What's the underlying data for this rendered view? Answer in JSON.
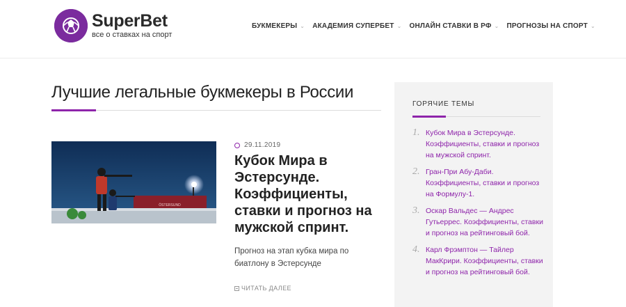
{
  "header": {
    "brand": "SuperBet",
    "tagline": "все о ставках на спорт",
    "nav": [
      {
        "label": "БУКМЕКЕРЫ"
      },
      {
        "label": "АКАДЕМИЯ СУПЕРБЕТ"
      },
      {
        "label": "ОНЛАЙН СТАВКИ В РФ"
      },
      {
        "label": "ПРОГНОЗЫ НА СПОРТ"
      }
    ]
  },
  "main": {
    "page_title": "Лучшие легальные букмекеры в России",
    "article": {
      "date": "29.11.2019",
      "title": "Кубок Мира в Эстерсунде. Коэффициенты, ставки и прогноз на мужской спринт.",
      "excerpt": "Прогноз на этап кубка мира по биатлону в Эстерсунде",
      "read_more": "ЧИТАТЬ ДАЛЕЕ",
      "image_caption": "ÖSTERSUND"
    }
  },
  "sidebar": {
    "title": "ГОРЯЧИЕ ТЕМЫ",
    "topics": [
      {
        "num": "1.",
        "text": "Кубок Мира в Эстерсунде. Коэффициенты, ставки и прогноз на мужской спринт."
      },
      {
        "num": "2.",
        "text": "Гран-При Абу-Даби. Коэффициенты, ставки и прогноз на Формулу-1."
      },
      {
        "num": "3.",
        "text": "Оскар Вальдес — Андрес Гутьеррес. Коэффициенты, ставки и прогноз на рейтинговый бой."
      },
      {
        "num": "4.",
        "text": "Карл Фрэмптон — Тайлер МакКрири. Коэффициенты, ставки и прогноз на рейтинговый бой."
      }
    ]
  },
  "colors": {
    "accent": "#8e24aa",
    "logo": "#7b2b9e",
    "sidebar_bg": "#f3f3f3"
  }
}
